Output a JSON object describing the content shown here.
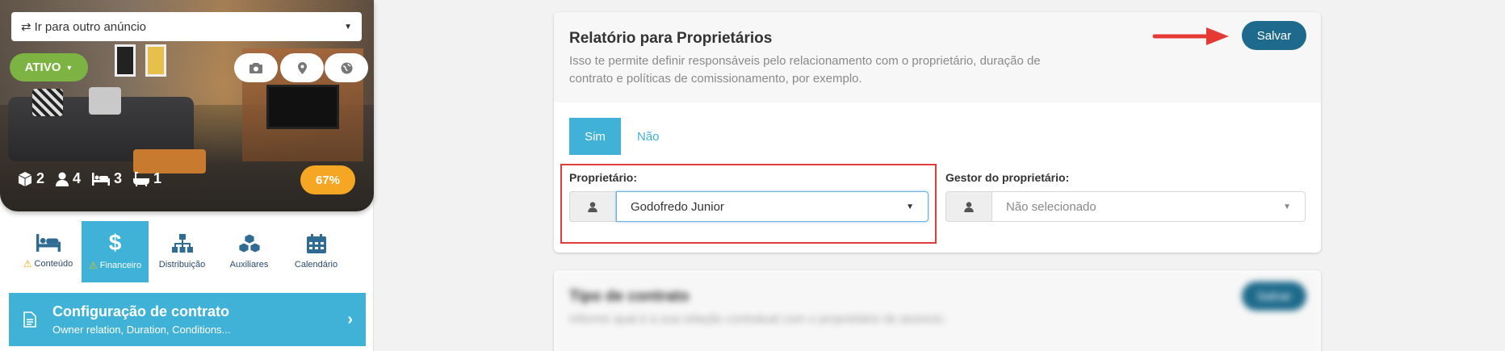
{
  "listing": {
    "goto_select": {
      "icon": "swap-arrows-icon",
      "label": "Ir para outro anúncio"
    },
    "status": {
      "label": "ATIVO",
      "color": "#7cb342"
    },
    "icon_buttons": [
      "camera-icon",
      "map-pin-icon",
      "globe-icon"
    ],
    "stats": [
      {
        "icon": "box-icon",
        "value": "2"
      },
      {
        "icon": "user-icon",
        "value": "4"
      },
      {
        "icon": "bed-icon",
        "value": "3"
      },
      {
        "icon": "bathtub-icon",
        "value": "1"
      }
    ],
    "completion": "67%"
  },
  "nav_tabs": [
    {
      "label": "Conteúdo",
      "icon": "bed-icon",
      "warning": true,
      "active": false
    },
    {
      "label": "Financeiro",
      "icon": "dollar-icon",
      "warning": true,
      "active": true
    },
    {
      "label": "Distribuição",
      "icon": "sitemap-icon",
      "warning": false,
      "active": false
    },
    {
      "label": "Auxiliares",
      "icon": "cubes-icon",
      "warning": false,
      "active": false
    },
    {
      "label": "Calendário",
      "icon": "calendar-icon",
      "warning": false,
      "active": false
    }
  ],
  "contract_config": {
    "title": "Configuração de contrato",
    "subtitle": "Owner relation, Duration, Conditions..."
  },
  "owner_report": {
    "title": "Relatório para Proprietários",
    "description": "Isso te permite definir responsáveis pelo relacionamento com o proprietário, duração de contrato e políticas de comissionamento, por exemplo.",
    "save_label": "Salvar",
    "toggle": {
      "yes": "Sim",
      "no": "Não",
      "selected": "Sim"
    },
    "owner_label": "Proprietário:",
    "owner_value": "Godofredo Junior",
    "manager_label": "Gestor do proprietário:",
    "manager_placeholder": "Não selecionado"
  },
  "contract_type": {
    "title": "Tipo de contrato",
    "description": "Informe qual é a sua relação contratual com o proprietário do anúncio.",
    "save_label": "Salvar"
  },
  "colors": {
    "accent": "#40b2d8",
    "primary_button": "#1e6a8c",
    "badge": "#f5a623",
    "highlight": "#e03c3c"
  }
}
